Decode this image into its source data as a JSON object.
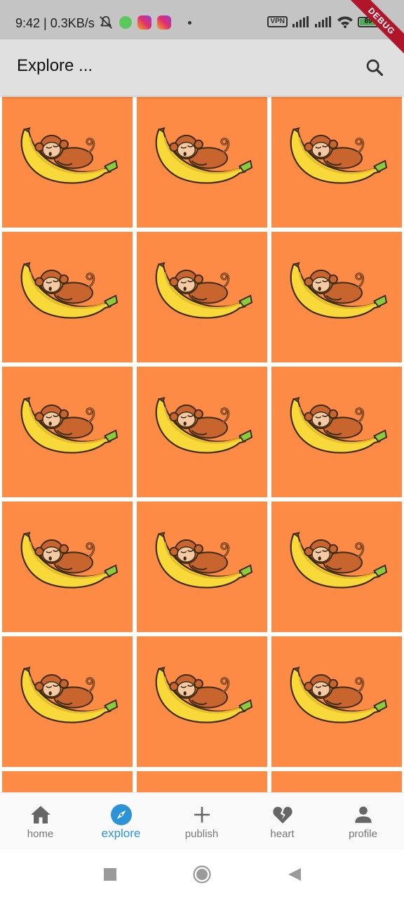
{
  "status_bar": {
    "time": "9:42 | 0.3KB/s",
    "vpn": "VPN",
    "battery": "89",
    "battery_level": 0.89
  },
  "debug_banner": "DEBUG",
  "app_bar": {
    "title": "Explore ...",
    "search_icon": "search-icon"
  },
  "grid": {
    "tile_color": "#fd8b45",
    "tile_image": "sleeping-monkey-on-banana",
    "columns": 3
  },
  "bottom_nav": {
    "active_color": "#2b93d6",
    "items": [
      {
        "label": "home",
        "icon": "home-icon"
      },
      {
        "label": "explore",
        "icon": "compass-icon",
        "active": true
      },
      {
        "label": "publish",
        "icon": "plus-icon"
      },
      {
        "label": "heart",
        "icon": "broken-heart-icon"
      },
      {
        "label": "profile",
        "icon": "person-icon"
      }
    ]
  },
  "system_nav": {
    "buttons": [
      "recents-button",
      "home-button",
      "back-button"
    ]
  }
}
